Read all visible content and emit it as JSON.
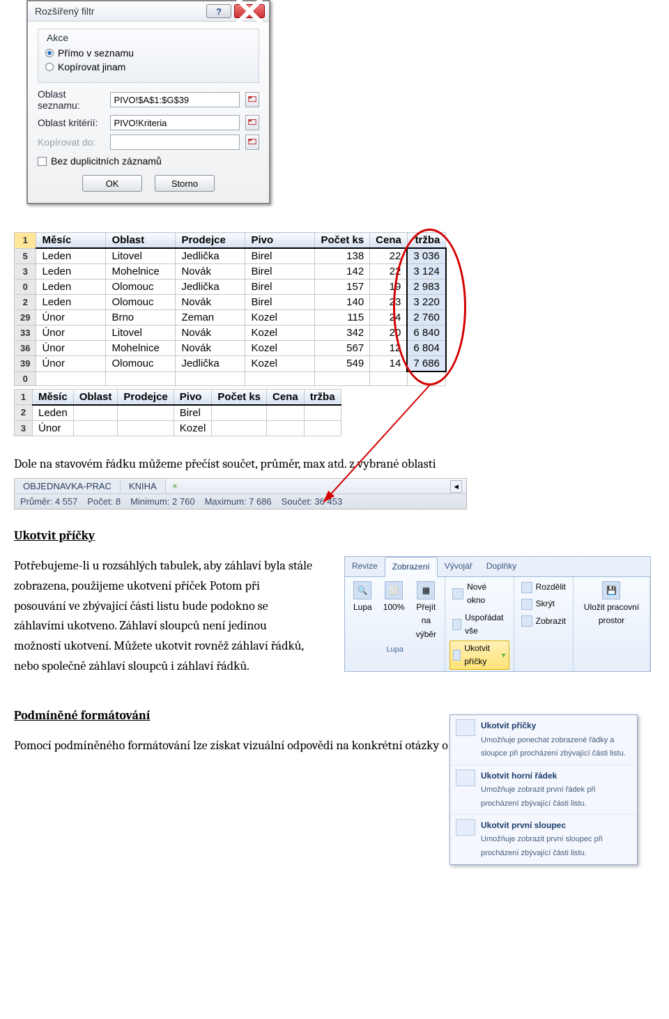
{
  "dialog": {
    "title": "Rozšířený filtr",
    "group_label": "Akce",
    "radio_inplace": "Přímo v seznamu",
    "radio_copy": "Kopírovat jinam",
    "label_listrange": "Oblast seznamu:",
    "value_listrange": "PIVO!$A$1:$G$39",
    "label_critrange": "Oblast kritérií:",
    "value_critrange": "PIVO!Kriteria",
    "label_copyto": "Kopírovat do:",
    "chk_unique": "Bez duplicitních záznamů",
    "btn_ok": "OK",
    "btn_cancel": "Storno"
  },
  "table1": {
    "headers": [
      "Měsíc",
      "Oblast",
      "Prodejce",
      "Pivo",
      "Počet ks",
      "Cena",
      "tržba"
    ],
    "row_ids": [
      "1",
      "5",
      "3",
      "0",
      "2",
      "29",
      "33",
      "36",
      "39",
      "0"
    ],
    "rows": [
      [
        "Leden",
        "Litovel",
        "Jedlička",
        "Birel",
        "138",
        "22",
        "3 036"
      ],
      [
        "Leden",
        "Mohelnice",
        "Novák",
        "Birel",
        "142",
        "22",
        "3 124"
      ],
      [
        "Leden",
        "Olomouc",
        "Jedlička",
        "Birel",
        "157",
        "19",
        "2 983"
      ],
      [
        "Leden",
        "Olomouc",
        "Novák",
        "Birel",
        "140",
        "23",
        "3 220"
      ],
      [
        "Únor",
        "Brno",
        "Zeman",
        "Kozel",
        "115",
        "24",
        "2 760"
      ],
      [
        "Únor",
        "Litovel",
        "Novák",
        "Kozel",
        "342",
        "20",
        "6 840"
      ],
      [
        "Únor",
        "Mohelnice",
        "Novák",
        "Kozel",
        "567",
        "12",
        "6 804"
      ],
      [
        "Únor",
        "Olomouc",
        "Jedlička",
        "Kozel",
        "549",
        "14",
        "7 686"
      ]
    ]
  },
  "table2": {
    "row_ids": [
      "1",
      "2",
      "3"
    ],
    "rows": [
      [
        "Leden",
        "",
        "",
        "Birel",
        "",
        "",
        ""
      ],
      [
        "Únor",
        "",
        "",
        "Kozel",
        "",
        "",
        ""
      ]
    ]
  },
  "para1": "Dole na stavovém řádku můžeme přečíst součet, průměr, max atd. z vybrané oblasti",
  "statusbar": {
    "tab1": "OBJEDNAVKA-PRAC",
    "tab2": "KNIHA",
    "s_avg": "Průměr: 4 557",
    "s_cnt": "Počet: 8",
    "s_min": "Minimum: 2 760",
    "s_max": "Maximum: 7 686",
    "s_sum": "Součet: 36 453"
  },
  "h_freeze": "Ukotvit příčky",
  "para_freeze": "Potřebujeme-li u rozsáhlých tabulek, aby záhlaví byla stále zobrazena, použijeme ukotvení příček Potom při posouvání ve zbývající části listu bude podokno se záhlavími ukotveno. Záhlaví sloupců není jedinou možností ukotvení. Můžete ukotvit rovněž záhlaví řádků, nebo společně záhlaví sloupců i záhlaví řádků.",
  "ribbon": {
    "tabs": [
      "Revize",
      "Zobrazení",
      "Vývojář",
      "Doplňky"
    ],
    "lupa": "Lupa",
    "zoom100": "100%",
    "zoom_sel": "Přejít na výběr",
    "grp_lupa": "Lupa",
    "new_win": "Nové okno",
    "arrange": "Uspořádat vše",
    "freeze": "Ukotvit příčky",
    "split": "Rozdělit",
    "hide": "Skrýt",
    "show": "Zobrazit",
    "save_ws": "Uložit pracovní prostor",
    "dd1_t": "Ukotvit příčky",
    "dd1_d": "Umožňuje ponechat zobrazené řádky a sloupce při procházení zbývající části listu.",
    "dd2_t": "Ukotvit horní řádek",
    "dd2_d": "Umožňuje zobrazit první řádek při procházení zbývající části listu.",
    "dd3_t": "Ukotvit první sloupec",
    "dd3_d": "Umožňuje zobrazit první sloupec při procházení zbývající části listu."
  },
  "h_cond": "Podmíněné formátování",
  "para_cond": "Pomocí podmíněného formátování lze získat vizuální odpovědi na konkrétní otázky o datech."
}
